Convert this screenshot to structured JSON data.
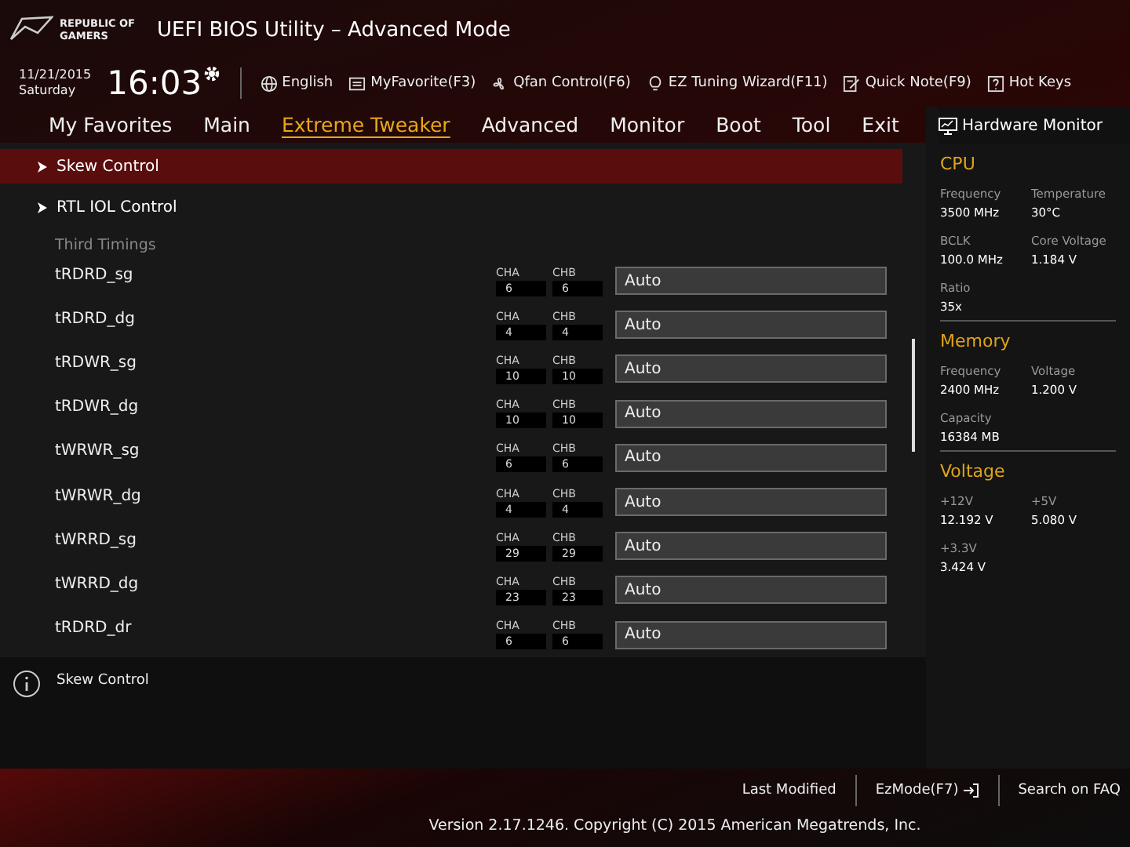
{
  "header": {
    "brand": [
      "REPUBLIC OF",
      "GAMERS"
    ],
    "title": "UEFI BIOS Utility – Advanced Mode"
  },
  "toolbar": {
    "date": "11/21/2015",
    "day": "Saturday",
    "time": "16:03",
    "items": [
      {
        "kind": "globe",
        "label": "English"
      },
      {
        "kind": "favorite",
        "label": "MyFavorite(F3)"
      },
      {
        "kind": "fan",
        "label": "Qfan Control(F6)"
      },
      {
        "kind": "bulb",
        "label": "EZ Tuning Wizard(F11)"
      },
      {
        "kind": "note",
        "label": "Quick Note(F9)"
      },
      {
        "kind": "help",
        "label": "Hot Keys"
      }
    ]
  },
  "tabs": [
    {
      "label": "My Favorites",
      "selected": false
    },
    {
      "label": "Main",
      "selected": false
    },
    {
      "label": "Extreme Tweaker",
      "selected": true
    },
    {
      "label": "Advanced",
      "selected": false
    },
    {
      "label": "Monitor",
      "selected": false
    },
    {
      "label": "Boot",
      "selected": false
    },
    {
      "label": "Tool",
      "selected": false
    },
    {
      "label": "Exit",
      "selected": false
    }
  ],
  "menu": [
    {
      "kind": "submenu",
      "label": "Skew Control",
      "selected": true
    },
    {
      "kind": "submenu",
      "label": "RTL IOL Control",
      "selected": false
    },
    {
      "kind": "heading",
      "label": "Third Timings"
    }
  ],
  "timings": [
    {
      "name": "tRDRD_sg",
      "channels": [
        {
          "label": "CHA",
          "value": "6"
        },
        {
          "label": "CHB",
          "value": "6"
        }
      ],
      "value": "Auto"
    },
    {
      "name": "tRDRD_dg",
      "channels": [
        {
          "label": "CHA",
          "value": "4"
        },
        {
          "label": "CHB",
          "value": "4"
        }
      ],
      "value": "Auto"
    },
    {
      "name": "tRDWR_sg",
      "channels": [
        {
          "label": "CHA",
          "value": "10"
        },
        {
          "label": "CHB",
          "value": "10"
        }
      ],
      "value": "Auto"
    },
    {
      "name": "tRDWR_dg",
      "channels": [
        {
          "label": "CHA",
          "value": "10"
        },
        {
          "label": "CHB",
          "value": "10"
        }
      ],
      "value": "Auto"
    },
    {
      "name": "tWRWR_sg",
      "channels": [
        {
          "label": "CHA",
          "value": "6"
        },
        {
          "label": "CHB",
          "value": "6"
        }
      ],
      "value": "Auto"
    },
    {
      "name": "tWRWR_dg",
      "channels": [
        {
          "label": "CHA",
          "value": "4"
        },
        {
          "label": "CHB",
          "value": "4"
        }
      ],
      "value": "Auto"
    },
    {
      "name": "tWRRD_sg",
      "channels": [
        {
          "label": "CHA",
          "value": "29"
        },
        {
          "label": "CHB",
          "value": "29"
        }
      ],
      "value": "Auto"
    },
    {
      "name": "tWRRD_dg",
      "channels": [
        {
          "label": "CHA",
          "value": "23"
        },
        {
          "label": "CHB",
          "value": "23"
        }
      ],
      "value": "Auto"
    },
    {
      "name": "tRDRD_dr",
      "channels": [
        {
          "label": "CHA",
          "value": "6"
        },
        {
          "label": "CHB",
          "value": "6"
        }
      ],
      "value": "Auto"
    }
  ],
  "help": {
    "text": "Skew Control"
  },
  "hardware_monitor": {
    "title": "Hardware Monitor",
    "sections": [
      {
        "title": "CPU",
        "stats": [
          {
            "label": "Frequency",
            "value": "3500 MHz"
          },
          {
            "label": "Temperature",
            "value": "30°C"
          },
          {
            "label": "BCLK",
            "value": "100.0 MHz"
          },
          {
            "label": "Core Voltage",
            "value": "1.184 V"
          },
          {
            "label": "Ratio",
            "value": "35x"
          }
        ]
      },
      {
        "title": "Memory",
        "stats": [
          {
            "label": "Frequency",
            "value": "2400 MHz"
          },
          {
            "label": "Voltage",
            "value": "1.200 V"
          },
          {
            "label": "Capacity",
            "value": "16384 MB"
          }
        ]
      },
      {
        "title": "Voltage",
        "stats": [
          {
            "label": "+12V",
            "value": "12.192 V"
          },
          {
            "label": "+5V",
            "value": "5.080 V"
          },
          {
            "label": "+3.3V",
            "value": "3.424 V"
          }
        ]
      }
    ]
  },
  "footer": {
    "links": [
      "Last Modified",
      "EzMode(F7)",
      "Search on FAQ"
    ],
    "version": "Version 2.17.1246. Copyright (C) 2015 American Megatrends, Inc."
  }
}
